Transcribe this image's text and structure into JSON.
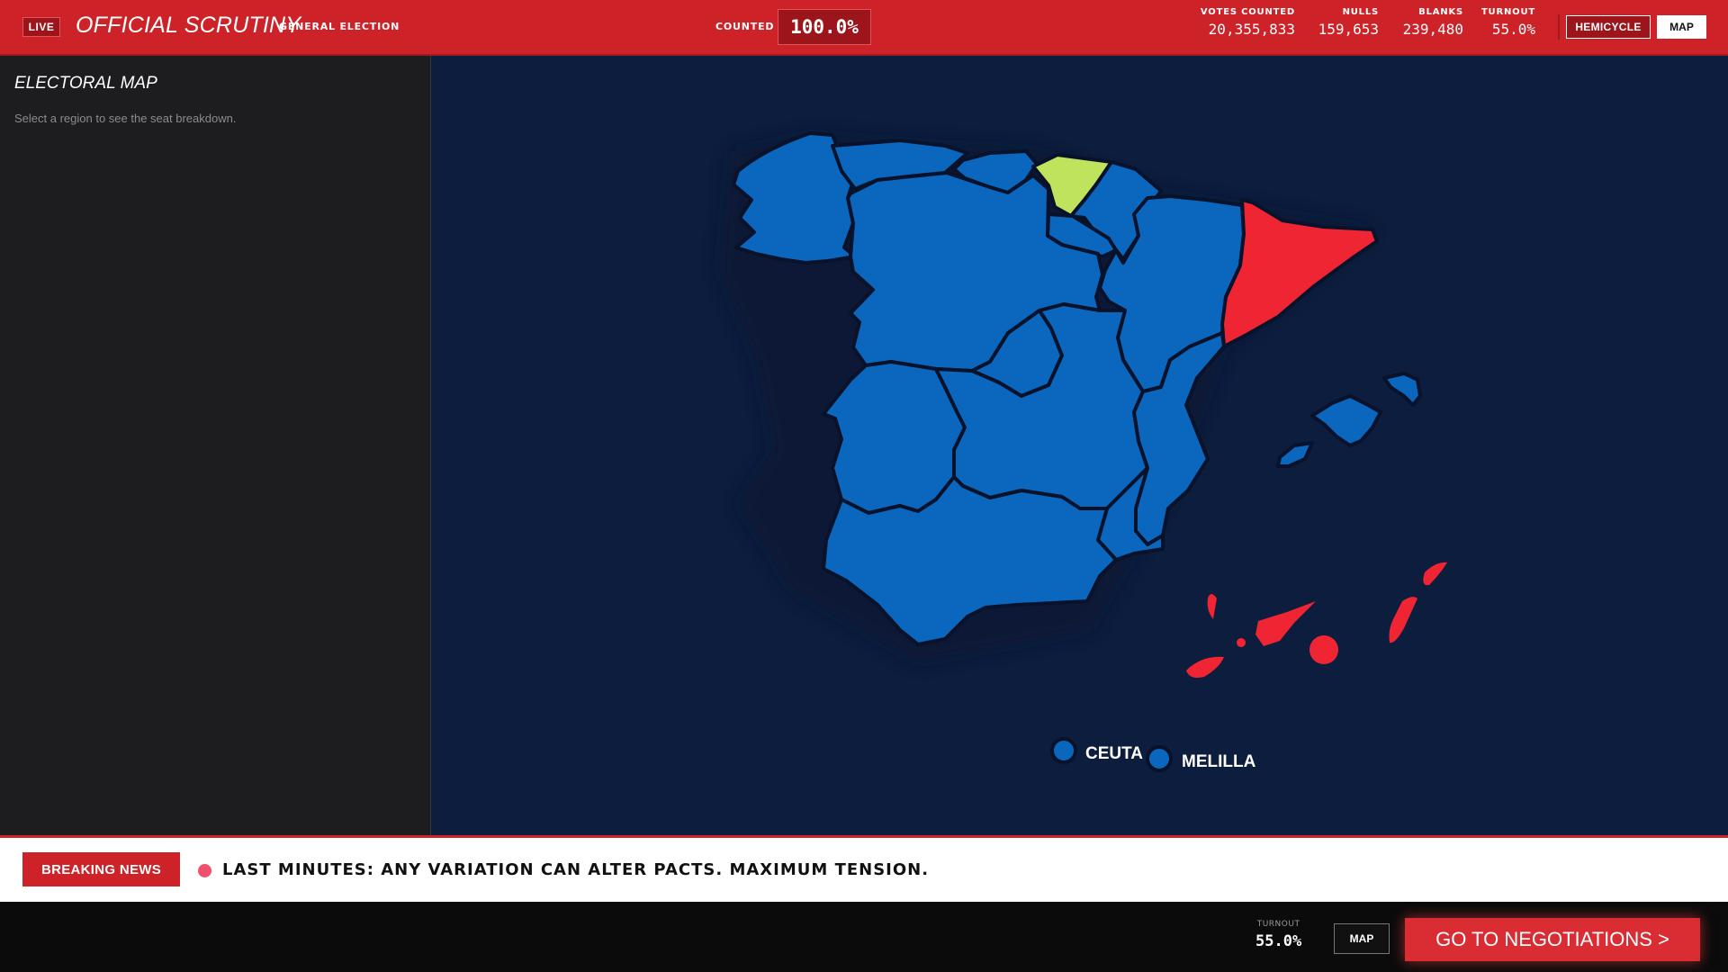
{
  "header": {
    "live_badge": "LIVE",
    "title": "OFFICIAL SCRUTINY",
    "subtitle": "GENERAL ELECTION",
    "counted_label": "COUNTED",
    "counted_value": "100.0%",
    "stats": [
      {
        "label": "VOTES COUNTED",
        "value": "20,355,833"
      },
      {
        "label": "NULLS",
        "value": "159,653"
      },
      {
        "label": "BLANKS",
        "value": "239,480"
      },
      {
        "label": "TURNOUT",
        "value": "55.0%"
      }
    ],
    "view_buttons": {
      "hemicycle": "HEMICYCLE",
      "map": "MAP"
    }
  },
  "panel": {
    "title": "ELECTORAL MAP",
    "help": "Select a region to see the seat breakdown."
  },
  "map": {
    "colors": {
      "blue": "#0b66bd",
      "red": "#f02533",
      "green": "#bfe35c"
    },
    "cities": [
      {
        "name": "CEUTA",
        "color": "blue"
      },
      {
        "name": "MELILLA",
        "color": "blue"
      }
    ]
  },
  "ticker": {
    "badge": "BREAKING NEWS",
    "text": "LAST MINUTES: ANY VARIATION CAN ALTER PACTS. MAXIMUM TENSION."
  },
  "footer": {
    "turnout_label": "TURNOUT",
    "turnout_value": "55.0%",
    "map_button": "MAP",
    "negotiations_button": "GO TO NEGOTIATIONS >"
  }
}
